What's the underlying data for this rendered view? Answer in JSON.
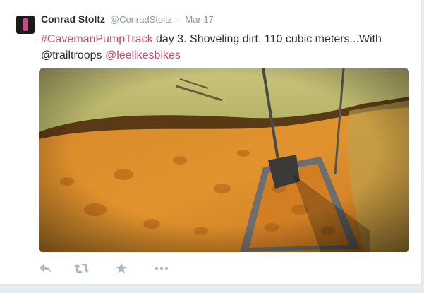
{
  "tweet": {
    "author": {
      "name": "Conrad Stoltz",
      "handle": "@ConradStoltz"
    },
    "separator": "·",
    "timestamp": "Mar 17",
    "text": {
      "hashtag": "#CavemanPumpTrack",
      "body": " day 3. Shoveling dirt. 110 cubic meters...With",
      "mention1": "@trailtroops",
      "mention2": "@leelikesbikes"
    },
    "colors": {
      "link": "#c94b6b",
      "name": "#292f33",
      "muted": "#8899a6",
      "icon": "#aab8c2"
    }
  },
  "actions": [
    {
      "icon": "reply-icon"
    },
    {
      "icon": "retweet-icon"
    },
    {
      "icon": "favorite-star-icon"
    },
    {
      "icon": "more-dots-icon"
    }
  ]
}
